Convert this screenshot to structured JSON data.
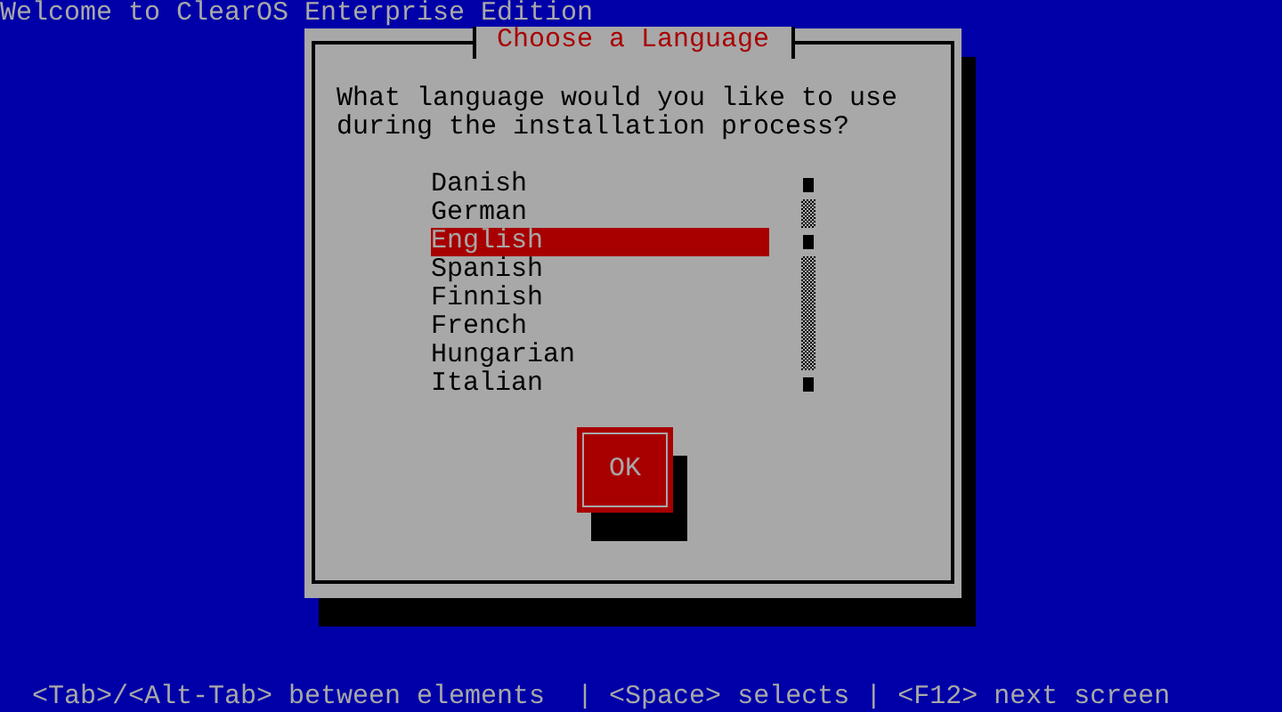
{
  "screen_title": "Welcome to ClearOS Enterprise Edition",
  "dialog": {
    "title": "Choose a Language",
    "prompt": "What language would you like to use during the installation process?",
    "languages": [
      {
        "label": "Danish",
        "selected": false
      },
      {
        "label": "German",
        "selected": false
      },
      {
        "label": "English",
        "selected": true
      },
      {
        "label": "Spanish",
        "selected": false
      },
      {
        "label": "Finnish",
        "selected": false
      },
      {
        "label": "French",
        "selected": false
      },
      {
        "label": "Hungarian",
        "selected": false
      },
      {
        "label": "Italian",
        "selected": false
      }
    ],
    "buttons": [
      {
        "label": "OK",
        "focused": true
      }
    ]
  },
  "status_bar": "<Tab>/<Alt-Tab> between elements  | <Space> selects | <F12> next screen"
}
